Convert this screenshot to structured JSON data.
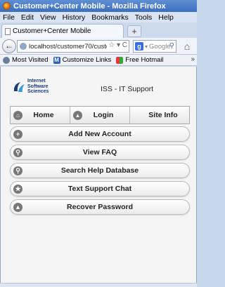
{
  "window": {
    "title": "Customer+Center Mobile - Mozilla Firefox"
  },
  "menu": {
    "items": [
      "File",
      "Edit",
      "View",
      "History",
      "Bookmarks",
      "Tools",
      "Help"
    ]
  },
  "tabs": [
    {
      "label": "Customer+Center Mobile"
    }
  ],
  "newtab_label": "+",
  "navbar": {
    "url": "localhost/customer70/custom",
    "search_placeholder": "Google"
  },
  "bookmarks": {
    "items": [
      {
        "label": "Most Visited",
        "icon": "gear-icon"
      },
      {
        "label": "Customize Links",
        "icon": "m-icon"
      },
      {
        "label": "Free Hotmail",
        "icon": "windows-flag-icon"
      }
    ],
    "more": "»"
  },
  "page": {
    "logo_lines": [
      "Internet",
      "Software",
      "Sciences"
    ],
    "title": "ISS - IT Support",
    "nav": [
      {
        "label": "Home",
        "icon": "home-icon"
      },
      {
        "label": "Login",
        "icon": "up-arrow-icon"
      },
      {
        "label": "Site Info",
        "icon": ""
      }
    ],
    "buttons": [
      {
        "label": "Add New Account",
        "icon": "plus-icon"
      },
      {
        "label": "View FAQ",
        "icon": "search-icon"
      },
      {
        "label": "Search Help Database",
        "icon": "search-icon"
      },
      {
        "label": "Text Support Chat",
        "icon": "star-icon"
      },
      {
        "label": "Recover Password",
        "icon": "alert-icon"
      }
    ]
  },
  "colors": {
    "titlebar": "#3b6fbf",
    "logo_blue": "#1d3b7a",
    "icon_gray": "#777777"
  }
}
